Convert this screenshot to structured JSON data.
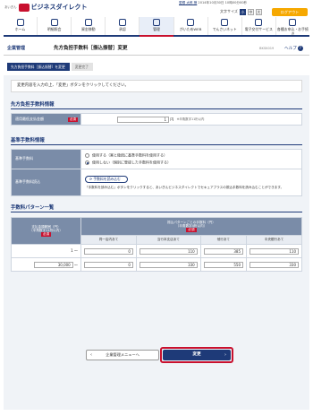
{
  "header": {
    "brand_small": "あいぎん",
    "brand_name": "ビジネスダイレクト",
    "user_name": "愛銀 太郎 様",
    "last_login": "2014年10月30日 10時00分00秒",
    "font_size_label": "文字サイズ",
    "font_sizes": [
      "小",
      "中",
      "大"
    ],
    "logout_label": "ログアウト",
    "nav": [
      "ホーム",
      "明細照会",
      "資金移動",
      "承認",
      "管理",
      "がいためWEB",
      "でんさいネット",
      "電子交付サービス",
      "各種お申込・お手続き"
    ]
  },
  "title_bar": {
    "category": "企業管理",
    "title": "先方負担手数料［振込振替］変更",
    "screen_code": "BKSK019",
    "help_label": "ヘルプ"
  },
  "steps": [
    "先方負担手数料［振込振替］を変更",
    "変更完了"
  ],
  "intro_text": "変更内容を入力の上、「変更」ボタンをクリックしてください。",
  "section1": {
    "title": "先方負担手数料情報",
    "row_label": "適用最低支払金額",
    "required": "必須",
    "value": "1",
    "unit": "円",
    "note": "※半角数字11桁以内"
  },
  "section2": {
    "title": "基準手数料情報",
    "row1_label": "基準手数料",
    "option1": "使用する（実と後続に基準手数料を使用する）",
    "option2": "使用しない（個別に登録した手数料を使用する）",
    "row2_label": "基準手数料読込",
    "load_button": "手数料を読み込む",
    "load_note": "「手数料を読み込む」ボタンをクリックすると、あいぎんビジネスダイレクトでセキュアプラスの振込手数料を読み込むことができます。"
  },
  "section3": {
    "title": "手数料パターン一覧",
    "col_amount": "支払金額範囲（円）",
    "col_amount_note": "（半角数字11桁以内）",
    "required": "必須",
    "col_group": "振込パターンごとの手数料（円）",
    "col_group_note": "（半角数字4桁以内）",
    "sub_cols": [
      "同一店内あて",
      "当行本支店あて",
      "他行あて",
      "中央銀行あて"
    ],
    "rows": [
      {
        "from": "",
        "to": "1 〜",
        "fees": [
          "0",
          "110",
          "385",
          "110"
        ]
      },
      {
        "from": "30,000",
        "to": "〜",
        "fees": [
          "0",
          "330",
          "550",
          "330"
        ]
      }
    ]
  },
  "buttons": {
    "back": "企業管理メニューへ",
    "change": "変更"
  }
}
